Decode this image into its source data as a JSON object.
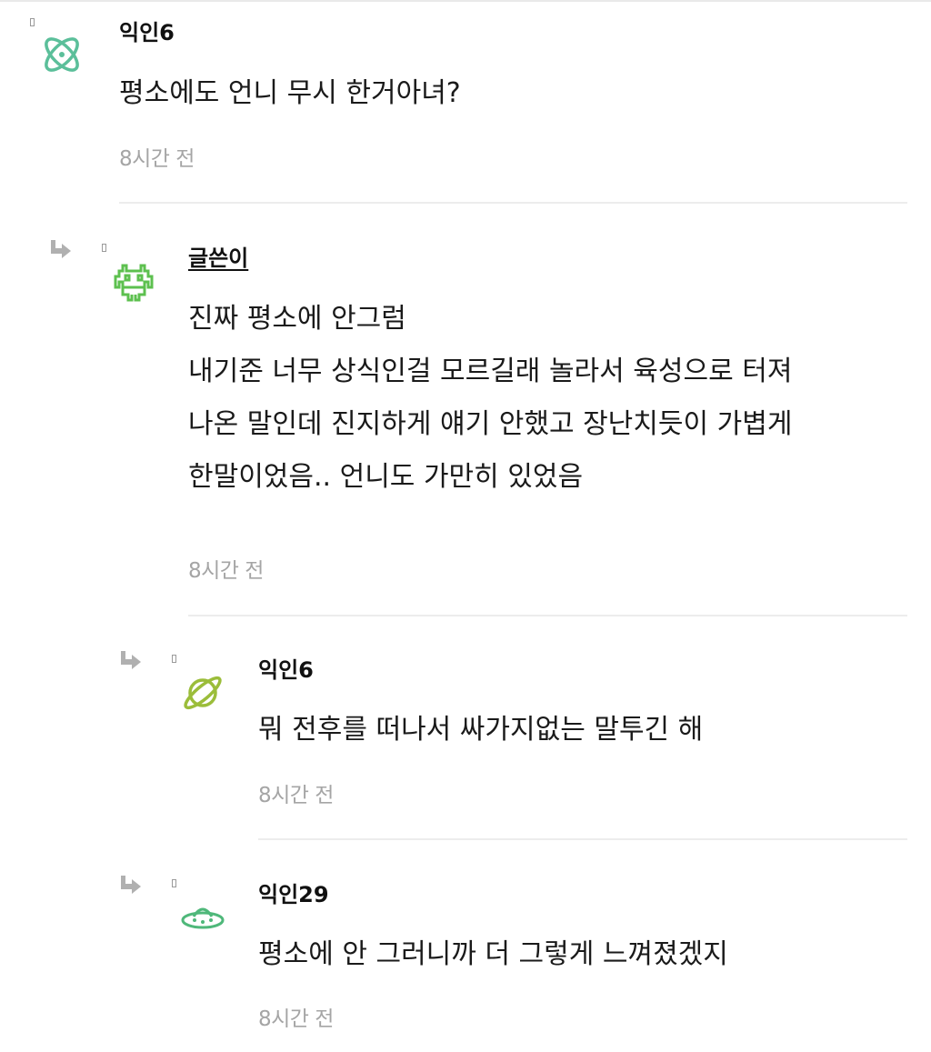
{
  "comments": [
    {
      "author": "익인6",
      "lines": [
        "평소에도 언니 무시 한거아녀?"
      ],
      "time": "8시간 전",
      "avatar_icon": "atom-icon",
      "avatar_color": "#5bbf9a"
    },
    {
      "author": "글쓴이",
      "lines": [
        "진짜 평소에 안그럼",
        "내기준 너무 상식인걸 모르길래 놀라서 육성으로 터져",
        "나온 말인데 진지하게 얘기 안했고 장난치듯이 가볍게",
        "한말이었음.. 언니도 가만히 있었음"
      ],
      "time": "8시간 전",
      "avatar_icon": "space-invader-icon",
      "avatar_color": "#5dc04f"
    },
    {
      "author": "익인6",
      "lines": [
        "뭐 전후를 떠나서 싸가지없는 말투긴 해"
      ],
      "time": "8시간 전",
      "avatar_icon": "planet-icon",
      "avatar_color": "#9bbd3a"
    },
    {
      "author": "익인29",
      "lines": [
        "평소에 안 그러니까 더 그렇게 느껴졌겠지"
      ],
      "time": "8시간 전",
      "avatar_icon": "ufo-icon",
      "avatar_color": "#4fb87a"
    }
  ],
  "colors": {
    "divider": "#ececec",
    "time_text": "#a5a5a5",
    "reply_arrow": "#b0b0b0"
  }
}
